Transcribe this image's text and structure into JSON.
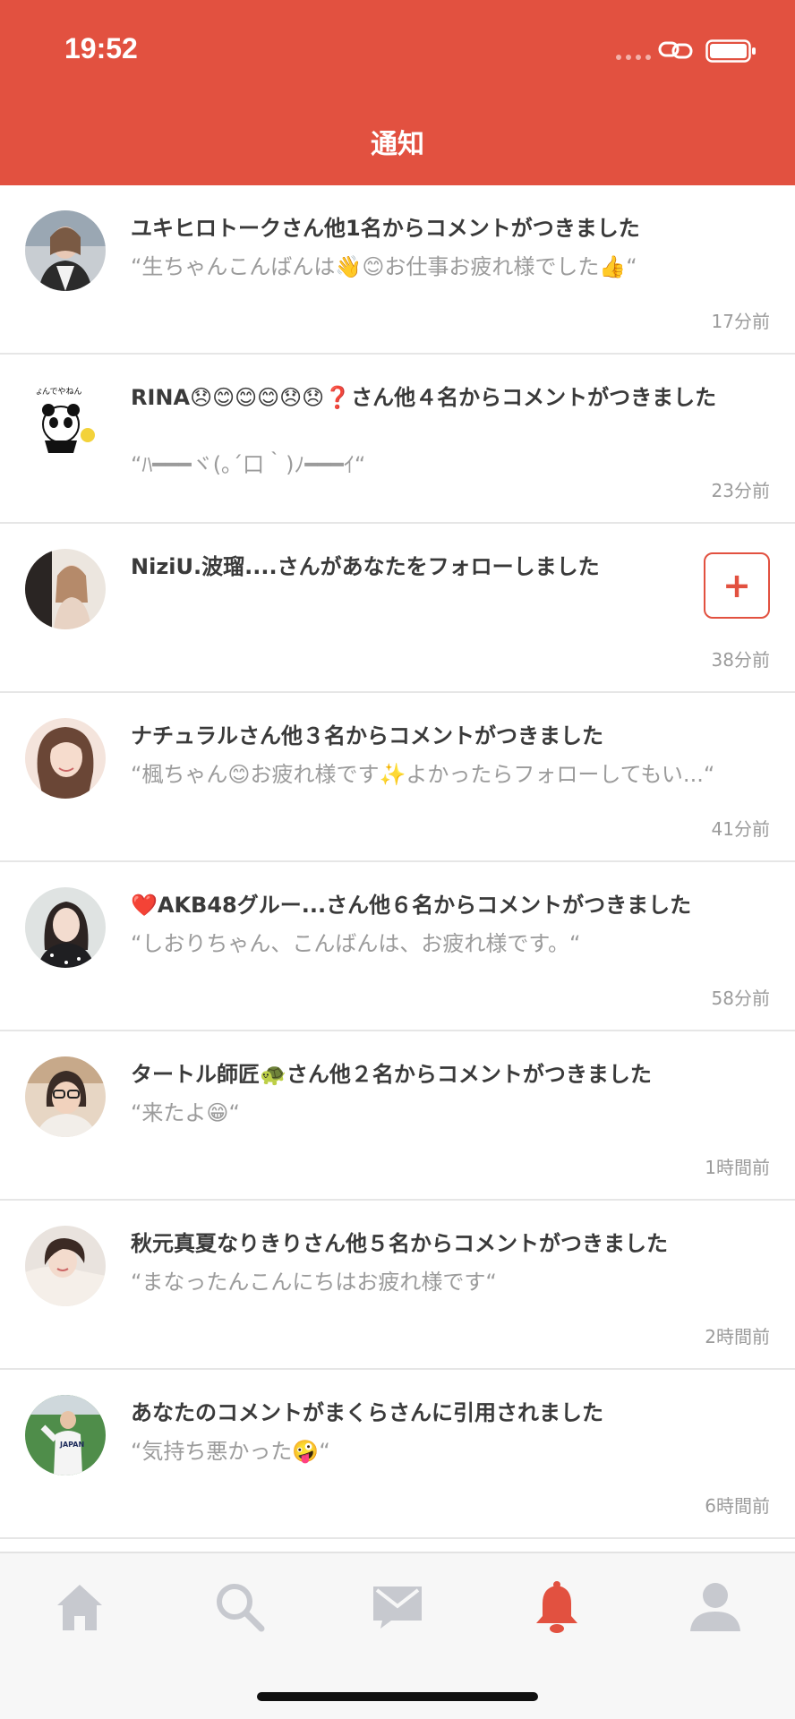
{
  "status_bar": {
    "time": "19:52"
  },
  "header": {
    "title": "通知"
  },
  "colors": {
    "accent": "#e25140",
    "inactive_tab": "#c7c9cf",
    "title_text": "#3a3a3a",
    "sub_text": "#9b9b9b"
  },
  "notifications": [
    {
      "title": "ユキヒロトークさん他1名からコメントがつきました",
      "comment": "“生ちゃんこんばんは👋😊お仕事お疲れ様でした👍“",
      "time": "17分前"
    },
    {
      "title": "RINA😞😊😊😊😞😞❓さん他４名からコメントがつきました",
      "comment": "“ﾊ━━━ヾ(｡´口｀)ﾉ━━━ｲ“",
      "time": "23分前"
    },
    {
      "title": "NiziU.波瑠....さんがあなたをフォローしました",
      "comment": "",
      "time": "38分前",
      "follow_symbol": "+"
    },
    {
      "title": "ナチュラルさん他３名からコメントがつきました",
      "comment": "“楓ちゃん😊お疲れ様です✨よかったらフォローしてもい...“",
      "time": "41分前"
    },
    {
      "title": "❤️AKB48グルー...さん他６名からコメントがつきました",
      "comment": "“しおりちゃん、こんばんは、お疲れ様です。“",
      "time": "58分前"
    },
    {
      "title": "タートル師匠🐢さん他２名からコメントがつきました",
      "comment": "“来たよ😁“",
      "time": "1時間前"
    },
    {
      "title": "秋元真夏なりきりさん他５名からコメントがつきました",
      "comment": "“まなったんこんにちはお疲れ様です“",
      "time": "2時間前"
    },
    {
      "title": "あなたのコメントがまくらさんに引用されました",
      "comment": "“気持ち悪かった🤪“",
      "time": "6時間前"
    }
  ],
  "tabs": [
    {
      "icon": "home-icon",
      "active": false
    },
    {
      "icon": "search-icon",
      "active": false
    },
    {
      "icon": "mail-icon",
      "active": false
    },
    {
      "icon": "bell-icon",
      "active": true
    },
    {
      "icon": "profile-icon",
      "active": false
    }
  ]
}
